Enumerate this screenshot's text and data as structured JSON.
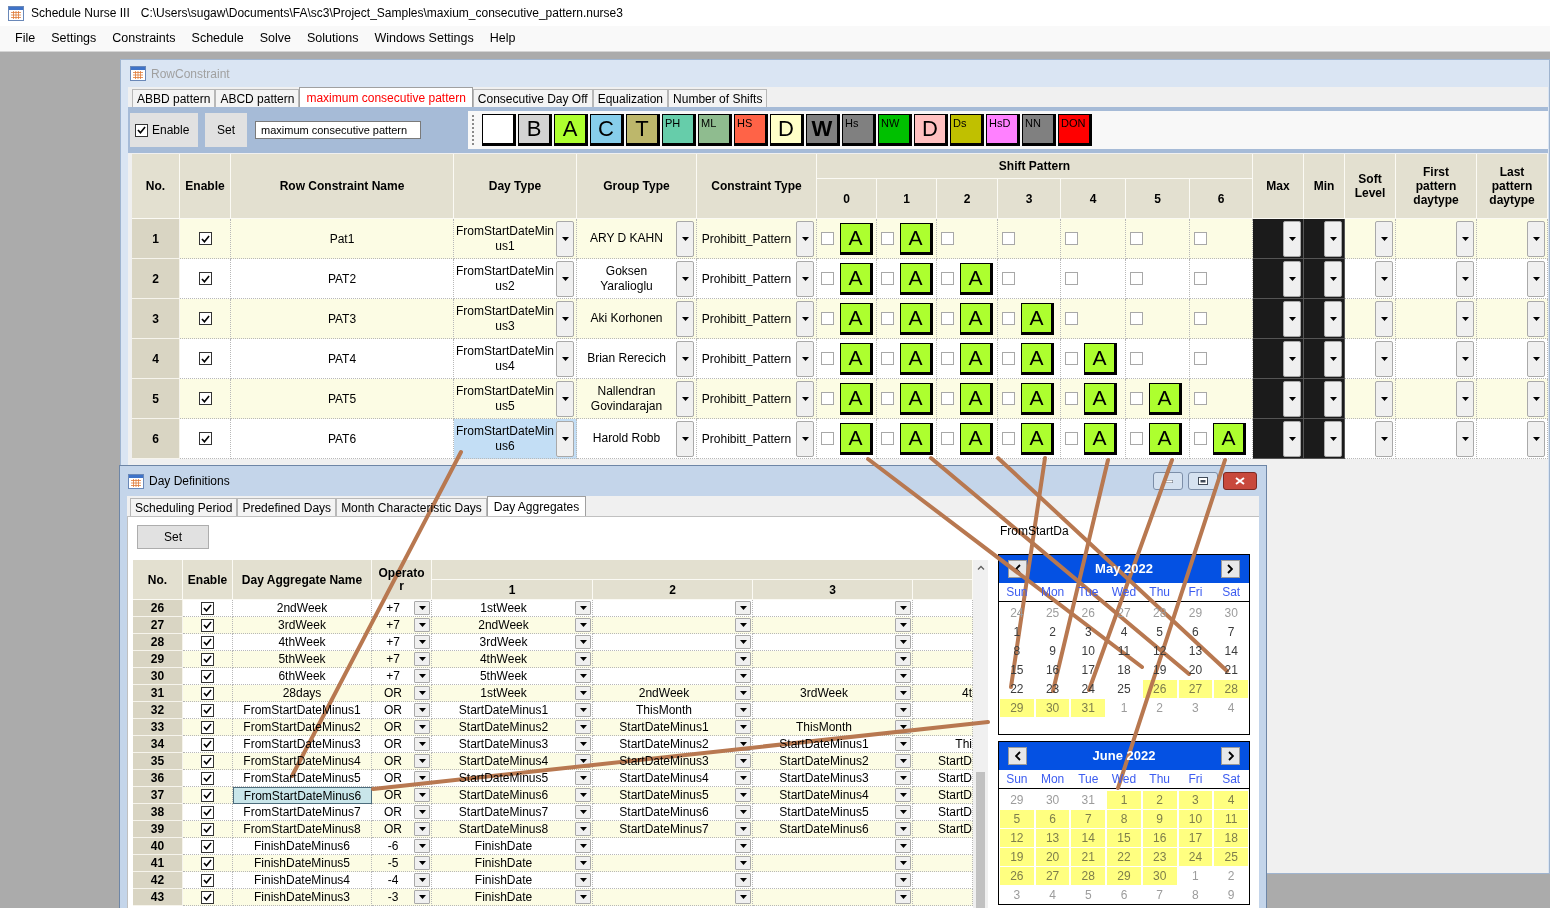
{
  "app": {
    "name": "Schedule Nurse III",
    "file_path": "C:\\Users\\sugaw\\Documents\\FA\\sc3\\Project_Samples\\maxium_consecutive_pattern.nurse3"
  },
  "menu": [
    "File",
    "Settings",
    "Constraints",
    "Schedule",
    "Solve",
    "Solutions",
    "Windows Settings",
    "Help"
  ],
  "row_constraint_window": {
    "title": "RowConstraint",
    "tabs": [
      {
        "label": "ABBD pattern",
        "selected": false
      },
      {
        "label": "ABCD pattern",
        "selected": false
      },
      {
        "label": "maximum consecutive pattern",
        "selected": true
      },
      {
        "label": "Consecutive Day Off",
        "selected": false
      },
      {
        "label": "Equalization",
        "selected": false
      },
      {
        "label": "Number of Shifts",
        "selected": false
      }
    ],
    "toolbar": {
      "enable": {
        "label": "Enable",
        "checked": true
      },
      "set_button": "Set",
      "name_field": "maximum consecutive pattern",
      "shift_buttons": [
        {
          "kind": "large",
          "color": "#ffffff"
        },
        {
          "kind": "large",
          "label": "B",
          "color": "#d3d3d3"
        },
        {
          "kind": "large",
          "label": "A",
          "color": "#adff2f"
        },
        {
          "kind": "large",
          "label": "C",
          "color": "#87ceeb"
        },
        {
          "kind": "large",
          "label": "T",
          "color": "#bdb76b"
        },
        {
          "kind": "small",
          "label": "PH",
          "color": "#66cdaa"
        },
        {
          "kind": "small",
          "label": "ML",
          "color": "#8fbc8f"
        },
        {
          "kind": "small",
          "label": "HS",
          "color": "#ff6347"
        },
        {
          "kind": "large",
          "label": "D",
          "color": "#ffffc8"
        },
        {
          "kind": "bold",
          "label": "W",
          "color": "#808080"
        },
        {
          "kind": "small",
          "label": "Hs",
          "color": "#808080"
        },
        {
          "kind": "small",
          "label": "NW",
          "color": "#00c000"
        },
        {
          "kind": "large",
          "label": "D",
          "color": "#ffc0c0"
        },
        {
          "kind": "small",
          "label": "Ds",
          "color": "#c0c000"
        },
        {
          "kind": "small",
          "label": "HsD",
          "color": "#ff80ff"
        },
        {
          "kind": "small",
          "label": "NN",
          "color": "#808080"
        },
        {
          "kind": "small",
          "label": "DON",
          "color": "#ff0000"
        }
      ]
    },
    "grid": {
      "headers": {
        "no": "No.",
        "enable": "Enable",
        "name": "Row Constraint Name",
        "day_type": "Day Type",
        "group_type": "Group Type",
        "constraint_type": "Constraint Type",
        "shift_pattern": "Shift Pattern",
        "shift_days": [
          "0",
          "1",
          "2",
          "3",
          "4",
          "5",
          "6"
        ],
        "max": "Max",
        "min": "Min",
        "soft_level": "Soft Level",
        "first_daytype": "First pattern daytype",
        "last_daytype": "Last pattern daytype"
      },
      "rows": [
        {
          "no": "1",
          "enabled": true,
          "name": "Pat1",
          "day_type": {
            "value": "FromStartDateMinus1",
            "selected": false
          },
          "group_type": "ARY D KAHN",
          "constraint_type": "Prohibitt_Pattern",
          "shifts": [
            {
              "checked": false,
              "shift": "A",
              "color": "#adff2f"
            },
            {
              "checked": false,
              "shift": "A",
              "color": "#adff2f"
            },
            {
              "checked": false
            },
            {
              "checked": false
            },
            {
              "checked": false
            },
            {
              "checked": false
            },
            {
              "checked": false
            }
          ]
        },
        {
          "no": "2",
          "enabled": true,
          "name": "PAT2",
          "day_type": {
            "value": "FromStartDateMinus2",
            "selected": false
          },
          "group_type": "Goksen Yaralioglu",
          "constraint_type": "Prohibitt_Pattern",
          "shifts": [
            {
              "checked": false,
              "shift": "A",
              "color": "#adff2f"
            },
            {
              "checked": false,
              "shift": "A",
              "color": "#adff2f"
            },
            {
              "checked": false,
              "shift": "A",
              "color": "#adff2f"
            },
            {
              "checked": false
            },
            {
              "checked": false
            },
            {
              "checked": false
            },
            {
              "checked": false
            }
          ]
        },
        {
          "no": "3",
          "enabled": true,
          "name": "PAT3",
          "day_type": {
            "value": "FromStartDateMinus3",
            "selected": false
          },
          "group_type": "Aki Korhonen",
          "constraint_type": "Prohibitt_Pattern",
          "shifts": [
            {
              "checked": false,
              "shift": "A",
              "color": "#adff2f"
            },
            {
              "checked": false,
              "shift": "A",
              "color": "#adff2f"
            },
            {
              "checked": false,
              "shift": "A",
              "color": "#adff2f"
            },
            {
              "checked": false,
              "shift": "A",
              "color": "#adff2f"
            },
            {
              "checked": false
            },
            {
              "checked": false
            },
            {
              "checked": false
            }
          ]
        },
        {
          "no": "4",
          "enabled": true,
          "name": "PAT4",
          "day_type": {
            "value": "FromStartDateMinus4",
            "selected": false
          },
          "group_type": "Brian Rerecich",
          "constraint_type": "Prohibitt_Pattern",
          "shifts": [
            {
              "checked": false,
              "shift": "A",
              "color": "#adff2f"
            },
            {
              "checked": false,
              "shift": "A",
              "color": "#adff2f"
            },
            {
              "checked": false,
              "shift": "A",
              "color": "#adff2f"
            },
            {
              "checked": false,
              "shift": "A",
              "color": "#adff2f"
            },
            {
              "checked": false,
              "shift": "A",
              "color": "#adff2f"
            },
            {
              "checked": false
            },
            {
              "checked": false
            }
          ]
        },
        {
          "no": "5",
          "enabled": true,
          "name": "PAT5",
          "day_type": {
            "value": "FromStartDateMinus5",
            "selected": false
          },
          "group_type": "Nallendran Govindarajan",
          "constraint_type": "Prohibitt_Pattern",
          "shifts": [
            {
              "checked": false,
              "shift": "A",
              "color": "#adff2f"
            },
            {
              "checked": false,
              "shift": "A",
              "color": "#adff2f"
            },
            {
              "checked": false,
              "shift": "A",
              "color": "#adff2f"
            },
            {
              "checked": false,
              "shift": "A",
              "color": "#adff2f"
            },
            {
              "checked": false,
              "shift": "A",
              "color": "#adff2f"
            },
            {
              "checked": false,
              "shift": "A",
              "color": "#adff2f"
            },
            {
              "checked": false
            }
          ]
        },
        {
          "no": "6",
          "enabled": true,
          "name": "PAT6",
          "day_type": {
            "value": "FromStartDateMinus6",
            "selected": true
          },
          "group_type": "Harold Robb",
          "constraint_type": "Prohibitt_Pattern",
          "shifts": [
            {
              "checked": false,
              "shift": "A",
              "color": "#adff2f"
            },
            {
              "checked": false,
              "shift": "A",
              "color": "#adff2f"
            },
            {
              "checked": false,
              "shift": "A",
              "color": "#adff2f"
            },
            {
              "checked": false,
              "shift": "A",
              "color": "#adff2f"
            },
            {
              "checked": false,
              "shift": "A",
              "color": "#adff2f"
            },
            {
              "checked": false,
              "shift": "A",
              "color": "#adff2f"
            },
            {
              "checked": false,
              "shift": "A",
              "color": "#adff2f"
            }
          ]
        }
      ]
    }
  },
  "day_definitions_window": {
    "title": "Day Definitions",
    "tabs": [
      {
        "label": "Scheduling Period",
        "selected": false
      },
      {
        "label": "Predefined Days",
        "selected": false
      },
      {
        "label": "Month Characteristic Days",
        "selected": false
      },
      {
        "label": "Day Aggregates",
        "selected": true
      }
    ],
    "set_button": "Set",
    "grid": {
      "headers": {
        "no": "No.",
        "enable": "Enable",
        "name": "Day Aggregate Name",
        "operator": "Operator",
        "items": [
          "1",
          "2",
          "3"
        ]
      },
      "rows": [
        {
          "no": "26",
          "enabled": true,
          "name": "2ndWeek",
          "selected": false,
          "operator": "+7",
          "col_1": "1stWeek"
        },
        {
          "no": "27",
          "enabled": true,
          "name": "3rdWeek",
          "selected": false,
          "operator": "+7",
          "col_1": "2ndWeek"
        },
        {
          "no": "28",
          "enabled": true,
          "name": "4thWeek",
          "selected": false,
          "operator": "+7",
          "col_1": "3rdWeek"
        },
        {
          "no": "29",
          "enabled": true,
          "name": "5thWeek",
          "selected": false,
          "operator": "+7",
          "col_1": "4thWeek"
        },
        {
          "no": "30",
          "enabled": true,
          "name": "6thWeek",
          "selected": false,
          "operator": "+7",
          "col_1": "5thWeek"
        },
        {
          "no": "31",
          "enabled": true,
          "name": "28days",
          "selected": false,
          "operator": "OR",
          "col_1": "1stWeek",
          "col_2": "2ndWeek",
          "col_3": "3rdWeek",
          "col_4": "4t"
        },
        {
          "no": "32",
          "enabled": true,
          "name": "FromStartDateMinus1",
          "selected": false,
          "operator": "OR",
          "col_1": "StartDateMinus1",
          "col_2": "ThisMonth"
        },
        {
          "no": "33",
          "enabled": true,
          "name": "FromStartDateMinus2",
          "selected": false,
          "operator": "OR",
          "col_1": "StartDateMinus2",
          "col_2": "StartDateMinus1",
          "col_3": "ThisMonth"
        },
        {
          "no": "34",
          "enabled": true,
          "name": "FromStartDateMinus3",
          "selected": false,
          "operator": "OR",
          "col_1": "StartDateMinus3",
          "col_2": "StartDateMinus2",
          "col_3": "StartDateMinus1",
          "col_4": "Thi"
        },
        {
          "no": "35",
          "enabled": true,
          "name": "FromStartDateMinus4",
          "selected": false,
          "operator": "OR",
          "col_1": "StartDateMinus4",
          "col_2": "StartDateMinus3",
          "col_3": "StartDateMinus2",
          "col_4": "StartD"
        },
        {
          "no": "36",
          "enabled": true,
          "name": "FromStartDateMinus5",
          "selected": false,
          "operator": "OR",
          "col_1": "StartDateMinus5",
          "col_2": "StartDateMinus4",
          "col_3": "StartDateMinus3",
          "col_4": "StartD"
        },
        {
          "no": "37",
          "enabled": true,
          "name": "FromStartDateMinus6",
          "selected": true,
          "operator": "OR",
          "col_1": "StartDateMinus6",
          "col_2": "StartDateMinus5",
          "col_3": "StartDateMinus4",
          "col_4": "StartD"
        },
        {
          "no": "38",
          "enabled": true,
          "name": "FromStartDateMinus7",
          "selected": false,
          "operator": "OR",
          "col_1": "StartDateMinus7",
          "col_2": "StartDateMinus6",
          "col_3": "StartDateMinus5",
          "col_4": "StartD"
        },
        {
          "no": "39",
          "enabled": true,
          "name": "FromStartDateMinus8",
          "selected": false,
          "operator": "OR",
          "col_1": "StartDateMinus8",
          "col_2": "StartDateMinus7",
          "col_3": "StartDateMinus6",
          "col_4": "StartD"
        },
        {
          "no": "40",
          "enabled": true,
          "name": "FinishDateMinus6",
          "selected": false,
          "operator": "-6",
          "col_1": "FinishDate"
        },
        {
          "no": "41",
          "enabled": true,
          "name": "FinishDateMinus5",
          "selected": false,
          "operator": "-5",
          "col_1": "FinishDate"
        },
        {
          "no": "42",
          "enabled": true,
          "name": "FinishDateMinus4",
          "selected": false,
          "operator": "-4",
          "col_1": "FinishDate"
        },
        {
          "no": "43",
          "enabled": true,
          "name": "FinishDateMinus3",
          "selected": false,
          "operator": "-3",
          "col_1": "FinishDate"
        }
      ]
    },
    "calendar_panel": {
      "label": "FromStartDa",
      "calendars": [
        {
          "title": "May 2022",
          "weekdays": [
            "Sun",
            "Mon",
            "Tue",
            "Wed",
            "Thu",
            "Fri",
            "Sat"
          ],
          "weeks": [
            [
              {
                "day": "24",
                "in_month": false,
                "selected": false
              },
              {
                "day": "25",
                "in_month": false,
                "selected": false
              },
              {
                "day": "26",
                "in_month": false,
                "selected": false
              },
              {
                "day": "27",
                "in_month": false,
                "selected": false
              },
              {
                "day": "28",
                "in_month": false,
                "selected": false
              },
              {
                "day": "29",
                "in_month": false,
                "selected": false
              },
              {
                "day": "30",
                "in_month": false,
                "selected": false
              }
            ],
            [
              {
                "day": "1",
                "in_month": true,
                "selected": false
              },
              {
                "day": "2",
                "in_month": true,
                "selected": false
              },
              {
                "day": "3",
                "in_month": true,
                "selected": false
              },
              {
                "day": "4",
                "in_month": true,
                "selected": false
              },
              {
                "day": "5",
                "in_month": true,
                "selected": false
              },
              {
                "day": "6",
                "in_month": true,
                "selected": false
              },
              {
                "day": "7",
                "in_month": true,
                "selected": false
              }
            ],
            [
              {
                "day": "8",
                "in_month": true,
                "selected": false
              },
              {
                "day": "9",
                "in_month": true,
                "selected": false
              },
              {
                "day": "10",
                "in_month": true,
                "selected": false
              },
              {
                "day": "11",
                "in_month": true,
                "selected": false
              },
              {
                "day": "12",
                "in_month": true,
                "selected": false
              },
              {
                "day": "13",
                "in_month": true,
                "selected": false
              },
              {
                "day": "14",
                "in_month": true,
                "selected": false
              }
            ],
            [
              {
                "day": "15",
                "in_month": true,
                "selected": false
              },
              {
                "day": "16",
                "in_month": true,
                "selected": false
              },
              {
                "day": "17",
                "in_month": true,
                "selected": false
              },
              {
                "day": "18",
                "in_month": true,
                "selected": false
              },
              {
                "day": "19",
                "in_month": true,
                "selected": false
              },
              {
                "day": "20",
                "in_month": true,
                "selected": false
              },
              {
                "day": "21",
                "in_month": true,
                "selected": false
              }
            ],
            [
              {
                "day": "22",
                "in_month": true,
                "selected": false
              },
              {
                "day": "23",
                "in_month": true,
                "selected": false
              },
              {
                "day": "24",
                "in_month": true,
                "selected": false
              },
              {
                "day": "25",
                "in_month": true,
                "selected": false
              },
              {
                "day": "26",
                "in_month": true,
                "selected": true
              },
              {
                "day": "27",
                "in_month": true,
                "selected": true
              },
              {
                "day": "28",
                "in_month": true,
                "selected": true
              }
            ],
            [
              {
                "day": "29",
                "in_month": true,
                "selected": true
              },
              {
                "day": "30",
                "in_month": true,
                "selected": true
              },
              {
                "day": "31",
                "in_month": true,
                "selected": true
              },
              {
                "day": "1",
                "in_month": false,
                "selected": false
              },
              {
                "day": "2",
                "in_month": false,
                "selected": false
              },
              {
                "day": "3",
                "in_month": false,
                "selected": false
              },
              {
                "day": "4",
                "in_month": false,
                "selected": false
              }
            ]
          ]
        },
        {
          "title": "June 2022",
          "weekdays": [
            "Sun",
            "Mon",
            "Tue",
            "Wed",
            "Thu",
            "Fri",
            "Sat"
          ],
          "weeks": [
            [
              {
                "day": "29",
                "in_month": false,
                "selected": false
              },
              {
                "day": "30",
                "in_month": false,
                "selected": false
              },
              {
                "day": "31",
                "in_month": false,
                "selected": false
              },
              {
                "day": "1",
                "in_month": true,
                "selected": true
              },
              {
                "day": "2",
                "in_month": true,
                "selected": true
              },
              {
                "day": "3",
                "in_month": true,
                "selected": true
              },
              {
                "day": "4",
                "in_month": true,
                "selected": true
              }
            ],
            [
              {
                "day": "5",
                "in_month": true,
                "selected": true
              },
              {
                "day": "6",
                "in_month": true,
                "selected": true
              },
              {
                "day": "7",
                "in_month": true,
                "selected": true
              },
              {
                "day": "8",
                "in_month": true,
                "selected": true
              },
              {
                "day": "9",
                "in_month": true,
                "selected": true
              },
              {
                "day": "10",
                "in_month": true,
                "selected": true
              },
              {
                "day": "11",
                "in_month": true,
                "selected": true
              }
            ],
            [
              {
                "day": "12",
                "in_month": true,
                "selected": true
              },
              {
                "day": "13",
                "in_month": true,
                "selected": true
              },
              {
                "day": "14",
                "in_month": true,
                "selected": true
              },
              {
                "day": "15",
                "in_month": true,
                "selected": true
              },
              {
                "day": "16",
                "in_month": true,
                "selected": true
              },
              {
                "day": "17",
                "in_month": true,
                "selected": true
              },
              {
                "day": "18",
                "in_month": true,
                "selected": true
              }
            ],
            [
              {
                "day": "19",
                "in_month": true,
                "selected": true
              },
              {
                "day": "20",
                "in_month": true,
                "selected": true
              },
              {
                "day": "21",
                "in_month": true,
                "selected": true
              },
              {
                "day": "22",
                "in_month": true,
                "selected": true
              },
              {
                "day": "23",
                "in_month": true,
                "selected": true
              },
              {
                "day": "24",
                "in_month": true,
                "selected": true
              },
              {
                "day": "25",
                "in_month": true,
                "selected": true
              }
            ],
            [
              {
                "day": "26",
                "in_month": true,
                "selected": true
              },
              {
                "day": "27",
                "in_month": true,
                "selected": true
              },
              {
                "day": "28",
                "in_month": true,
                "selected": true
              },
              {
                "day": "29",
                "in_month": true,
                "selected": true
              },
              {
                "day": "30",
                "in_month": true,
                "selected": true
              },
              {
                "day": "1",
                "in_month": false,
                "selected": false
              },
              {
                "day": "2",
                "in_month": false,
                "selected": false
              }
            ],
            [
              {
                "day": "3",
                "in_month": false,
                "selected": false
              },
              {
                "day": "4",
                "in_month": false,
                "selected": false
              },
              {
                "day": "5",
                "in_month": false,
                "selected": false
              },
              {
                "day": "6",
                "in_month": false,
                "selected": false
              },
              {
                "day": "7",
                "in_month": false,
                "selected": false
              },
              {
                "day": "8",
                "in_month": false,
                "selected": false
              },
              {
                "day": "9",
                "in_month": false,
                "selected": false
              }
            ]
          ]
        }
      ]
    }
  }
}
